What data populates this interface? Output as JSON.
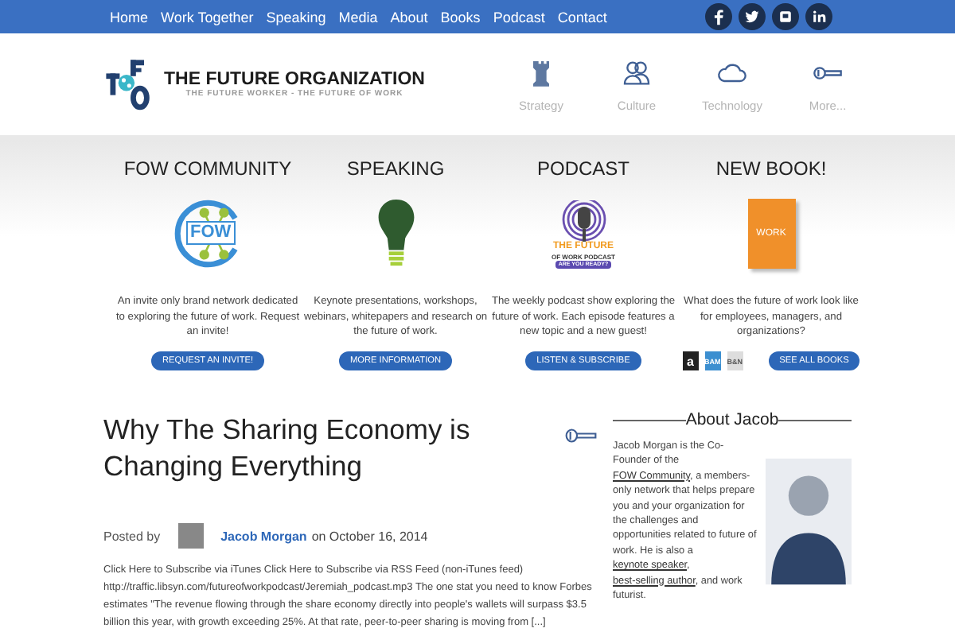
{
  "top_nav": {
    "items": [
      {
        "label": "Home"
      },
      {
        "label": "Work Together"
      },
      {
        "label": "Speaking"
      },
      {
        "label": "Media"
      },
      {
        "label": "About"
      },
      {
        "label": "Books"
      },
      {
        "label": "Podcast"
      },
      {
        "label": "Contact"
      }
    ],
    "social": [
      {
        "kind": "facebook"
      },
      {
        "kind": "twitter"
      },
      {
        "kind": "flickr"
      },
      {
        "kind": "linkedin"
      }
    ]
  },
  "header": {
    "title": "THE FUTURE ORGANIZATION",
    "tagline": "THE FUTURE WORKER - THE FUTURE OF WORK",
    "topics": [
      {
        "kind": "rook",
        "label": "Strategy"
      },
      {
        "kind": "people",
        "label": "Culture"
      },
      {
        "kind": "cloud",
        "label": "Technology"
      },
      {
        "kind": "key",
        "label": "More..."
      }
    ]
  },
  "features": [
    {
      "kind": "community",
      "heading": "FOW COMMUNITY",
      "logo_text": "FOW",
      "text": "An invite only brand network dedicated to exploring the future of work. Request an invite!",
      "button": "REQUEST AN INVITE!"
    },
    {
      "kind": "speaking",
      "heading": "SPEAKING",
      "text": "Keynote presentations, workshops, webinars, whitepapers and research on the future of work.",
      "button": "MORE INFORMATION"
    },
    {
      "kind": "podcast",
      "heading": "PODCAST",
      "logo_text": "THE FUTURE",
      "logo_sub": "OF WORK PODCAST",
      "logo_tag": "ARE YOU READY?",
      "text": "The weekly podcast show exploring the future of work. Each episode features a new topic and a new guest!",
      "button": "LISTEN & SUBSCRIBE"
    },
    {
      "kind": "book",
      "heading": "NEW BOOK!",
      "logo_text": "WORK",
      "text": "What does the future of work look like for employees, managers, and organizations?",
      "stores": [
        "a",
        "BAM",
        "B&N"
      ],
      "button": "SEE ALL BOOKS"
    }
  ],
  "article": {
    "title": "Why The Sharing Economy is Changing Everything",
    "posted_by": "Posted by",
    "author": "Jacob Morgan",
    "date": "on October 16, 2014",
    "excerpt": "Click Here to Subscribe via iTunes Click Here to Subscribe via RSS Feed (non-iTunes feed) http://traffic.libsyn.com/futureofworkpodcast/Jeremiah_podcast.mp3   The one stat you need to know Forbes estimates \"The revenue flowing through the share economy directly into people's wallets will surpass $3.5 billion this year, with growth exceeding 25%. At that rate, peer-to-peer sharing is moving from [...]"
  },
  "sidebar": {
    "heading": "About Jacob",
    "bio": [
      {
        "kind": "text",
        "text": "Jacob Morgan is the Co-Founder of the "
      },
      {
        "kind": "link",
        "text": "FOW Community"
      },
      {
        "kind": "text",
        "text": ", a members-only network that helps prepare you and your organization for the challenges and opportunities related to future of work. He is also a "
      },
      {
        "kind": "link",
        "text": "keynote speaker"
      },
      {
        "kind": "text",
        "text": ", "
      },
      {
        "kind": "link",
        "text": "best-selling author"
      },
      {
        "kind": "text",
        "text": ", and work futurist."
      }
    ]
  }
}
